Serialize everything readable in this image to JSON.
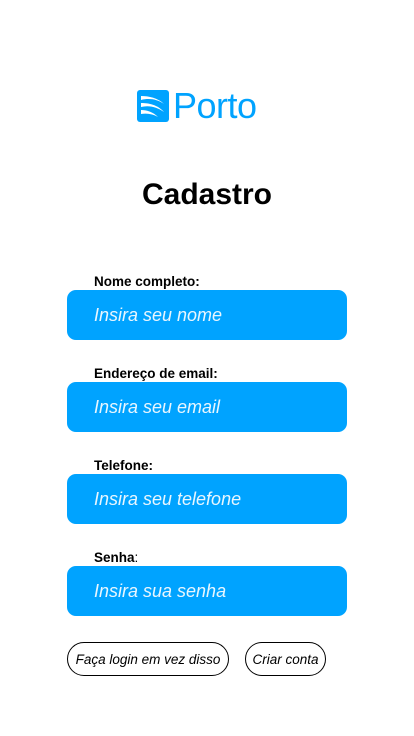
{
  "brand": {
    "name": "Porto",
    "color": "#00a3ff",
    "icon": "porto-sail-logo-icon"
  },
  "page": {
    "title": "Cadastro"
  },
  "form": {
    "name": {
      "label": "Nome completo:",
      "placeholder": "Insira seu nome",
      "value": ""
    },
    "email": {
      "label": "Endereço de email:",
      "placeholder": "Insira seu email",
      "value": ""
    },
    "phone": {
      "label": "Telefone:",
      "placeholder": "Insira seu telefone",
      "value": ""
    },
    "password": {
      "label": "Senha",
      "label_suffix": ":",
      "placeholder": "Insira sua senha",
      "value": ""
    }
  },
  "actions": {
    "login_label": "Faça login em vez disso",
    "create_label": "Criar conta"
  }
}
